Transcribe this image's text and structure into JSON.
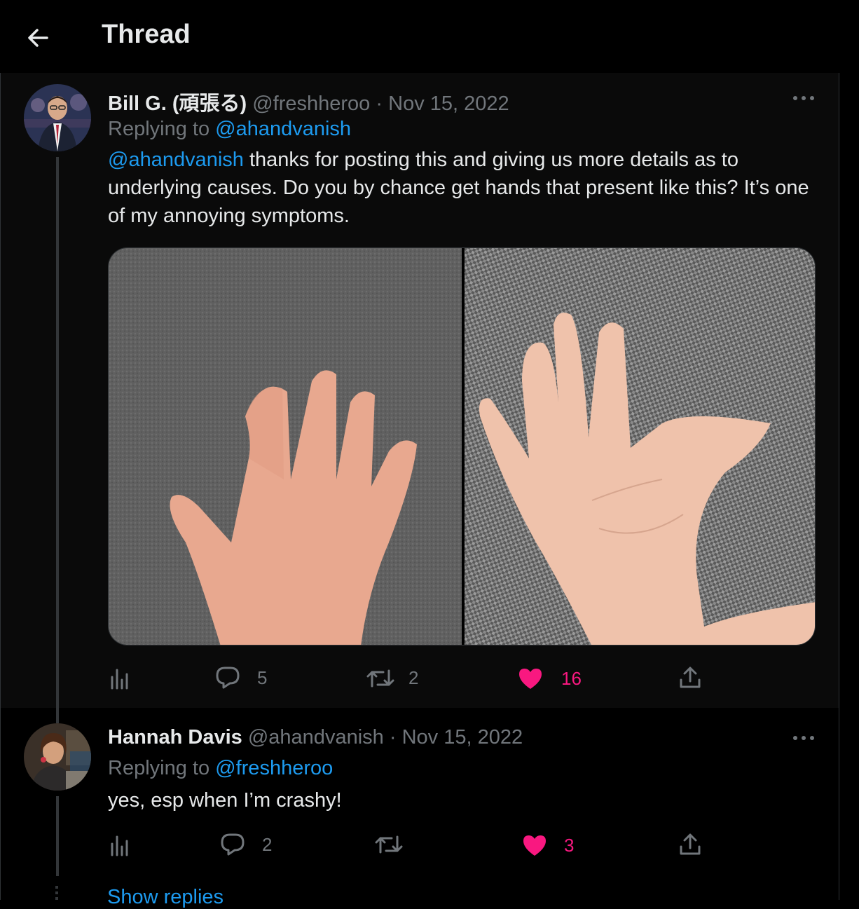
{
  "header": {
    "title": "Thread"
  },
  "tweets": [
    {
      "author_name": "Bill G. (頑張る)",
      "handle": "@freshheroo",
      "separator": "·",
      "date": "Nov 15, 2022",
      "replying_prefix": "Replying to",
      "replying_to": "@ahandvanish",
      "mention": "@ahandvanish",
      "text": " thanks for posting this and giving us more details as to underlying causes. Do you by chance get hands that present like this? It’s one of my annoying symptoms.",
      "media": [
        "left-hand-photo",
        "right-hand-photo"
      ],
      "stats": {
        "replies": "5",
        "retweets": "2",
        "likes": "16"
      },
      "liked": true
    },
    {
      "author_name": "Hannah Davis",
      "handle": "@ahandvanish",
      "separator": "·",
      "date": "Nov 15, 2022",
      "replying_prefix": "Replying to",
      "replying_to": "@freshheroo",
      "text": "yes, esp when I’m crashy!",
      "stats": {
        "replies": "2",
        "retweets": "",
        "likes": "3"
      },
      "liked": true
    }
  ],
  "footer": {
    "show_replies": "Show replies"
  },
  "colors": {
    "accent": "#1d9bf0",
    "like": "#f91880",
    "muted": "#71767b",
    "text": "#e7e9ea"
  },
  "icons": [
    "back-arrow-icon",
    "more-icon",
    "analytics-icon",
    "reply-icon",
    "retweet-icon",
    "heart-icon",
    "share-icon"
  ]
}
